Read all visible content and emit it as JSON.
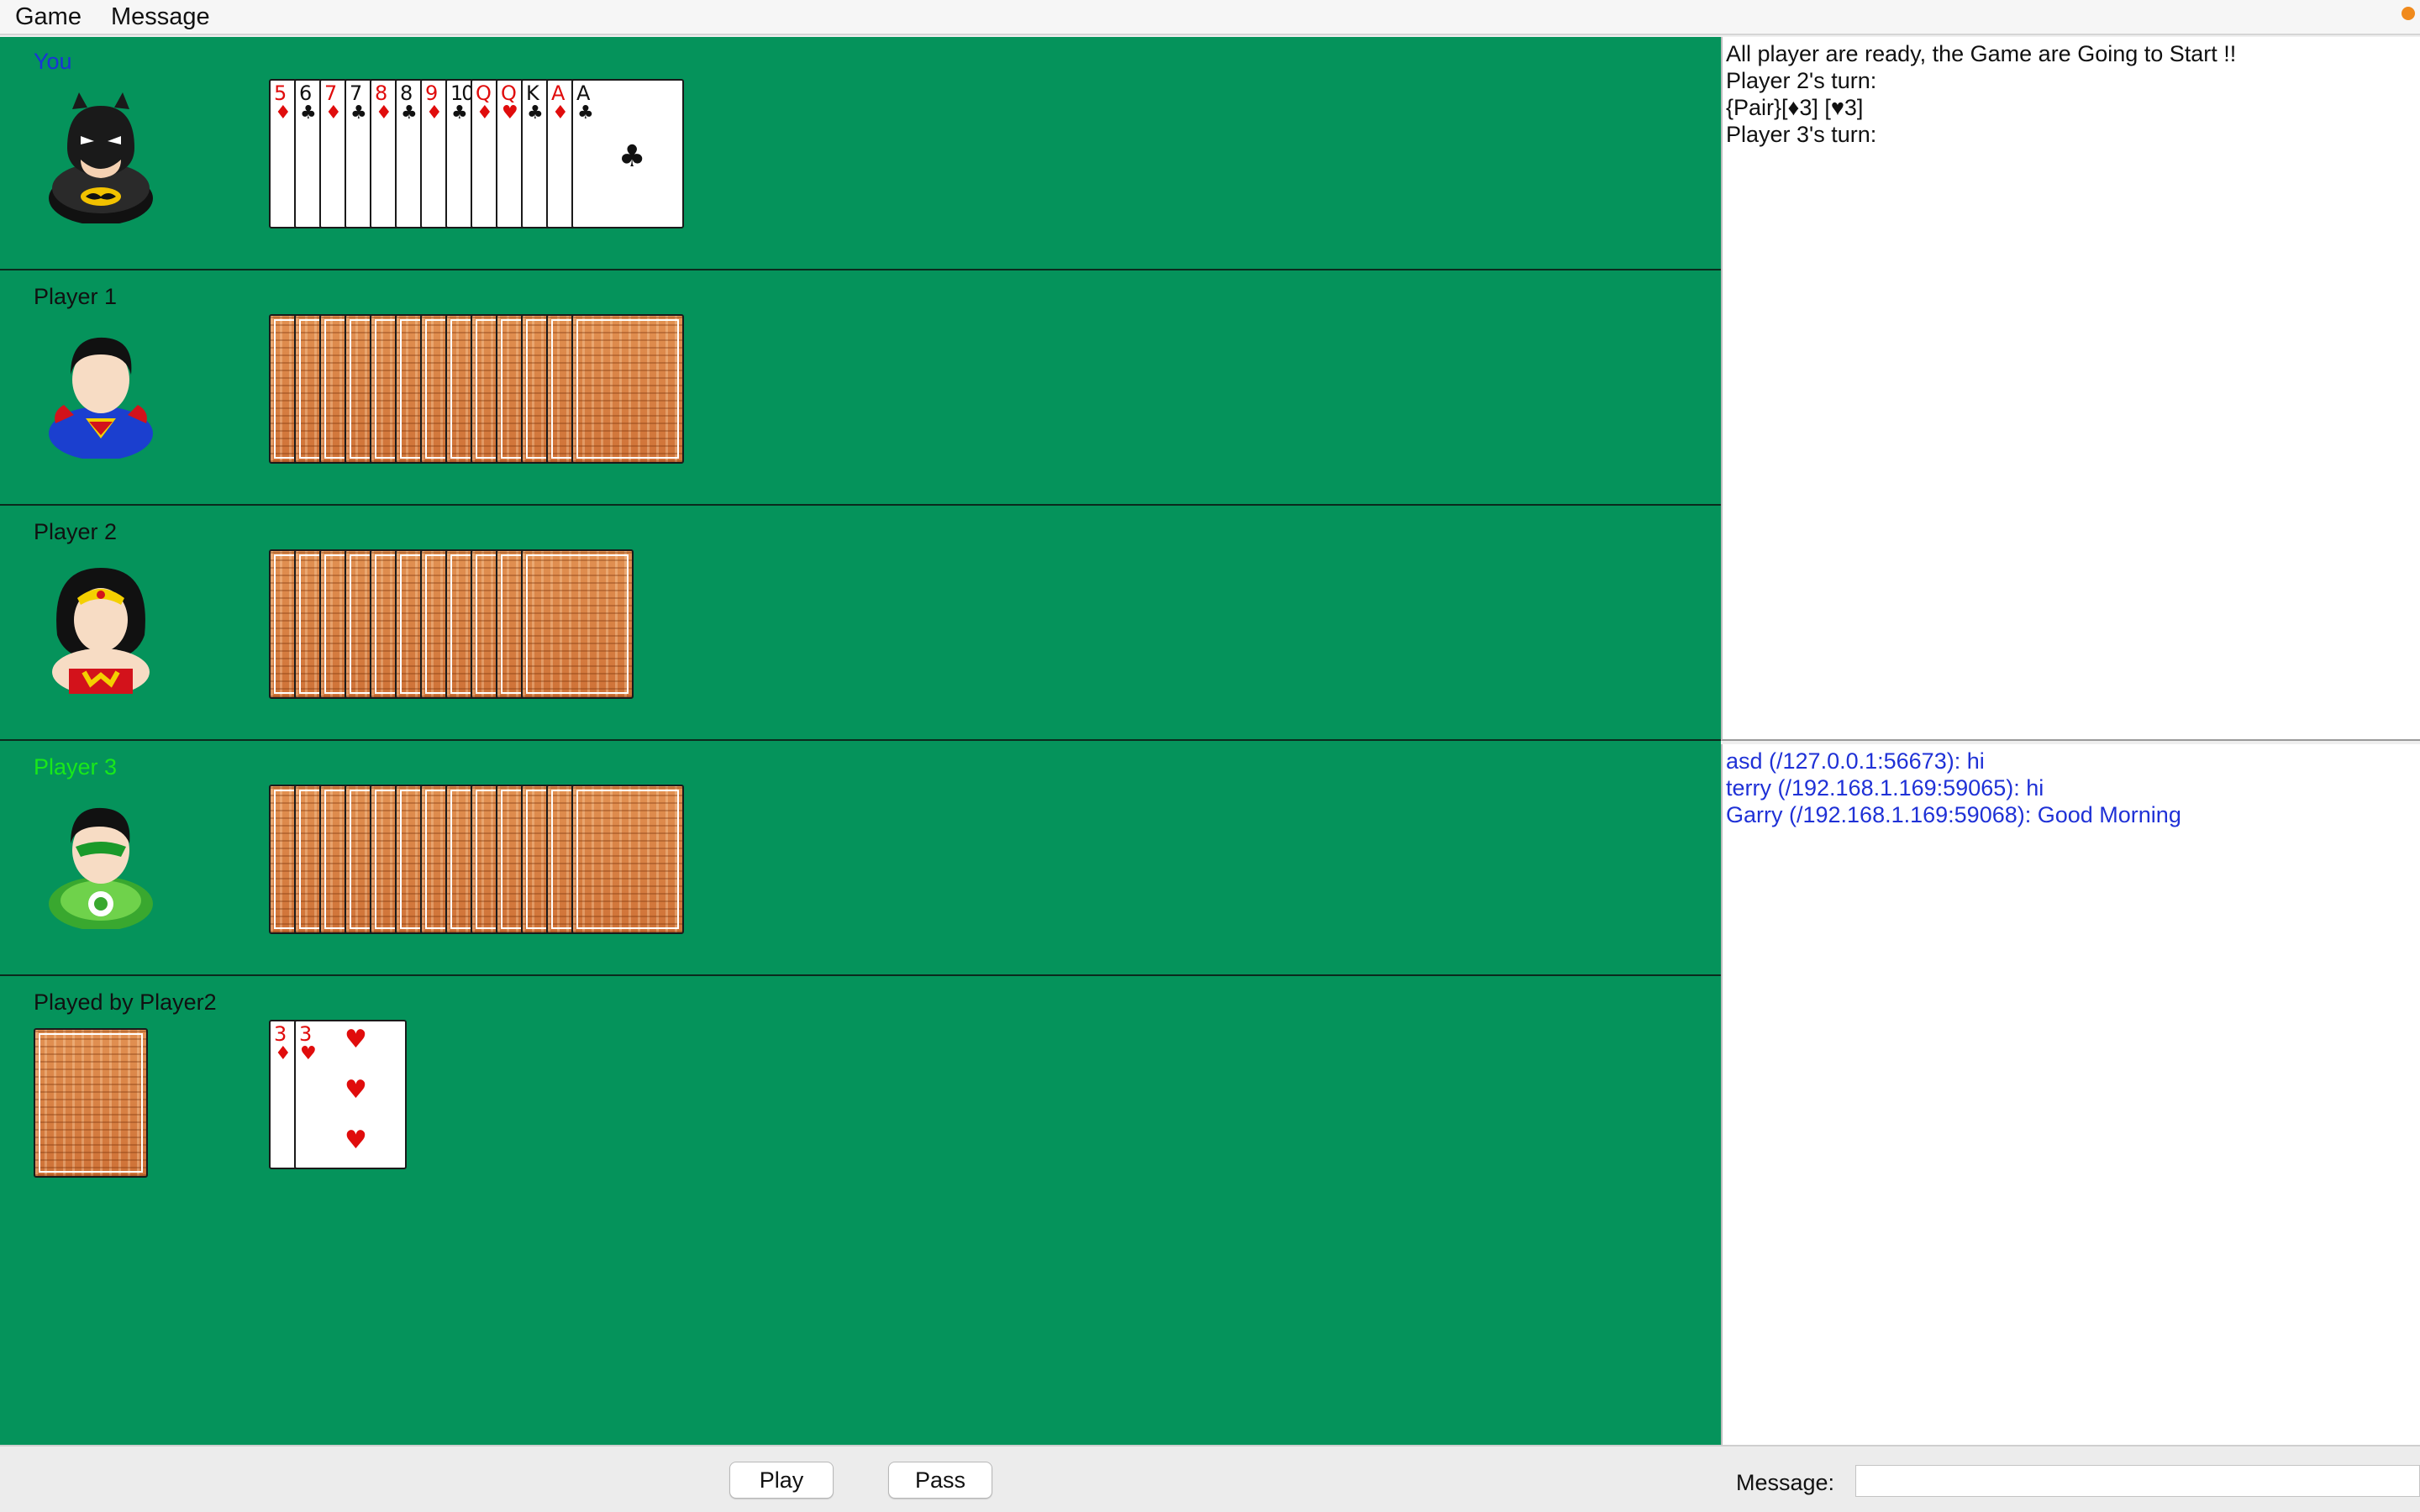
{
  "menu": {
    "game": "Game",
    "message": "Message"
  },
  "players": [
    {
      "name": "You",
      "name_color": "#1a33d8",
      "avatar": "batman-avatar"
    },
    {
      "name": "Player 1",
      "name_color": "#111111",
      "avatar": "superman-avatar",
      "card_count": 13
    },
    {
      "name": "Player 2",
      "name_color": "#111111",
      "avatar": "wonder-woman-avatar",
      "card_count": 11
    },
    {
      "name": "Player 3",
      "name_color": "#19e81a",
      "avatar": "green-lantern-avatar",
      "card_count": 13
    }
  ],
  "your_hand": [
    {
      "rank": "5",
      "suit": "♦",
      "color": "red"
    },
    {
      "rank": "6",
      "suit": "♣",
      "color": "black"
    },
    {
      "rank": "7",
      "suit": "♦",
      "color": "red"
    },
    {
      "rank": "7",
      "suit": "♣",
      "color": "black"
    },
    {
      "rank": "8",
      "suit": "♦",
      "color": "red"
    },
    {
      "rank": "8",
      "suit": "♣",
      "color": "black"
    },
    {
      "rank": "9",
      "suit": "♦",
      "color": "red"
    },
    {
      "rank": "10",
      "suit": "♣",
      "color": "black"
    },
    {
      "rank": "Q",
      "suit": "♦",
      "color": "red"
    },
    {
      "rank": "Q",
      "suit": "♥",
      "color": "red"
    },
    {
      "rank": "K",
      "suit": "♣",
      "color": "black"
    },
    {
      "rank": "A",
      "suit": "♦",
      "color": "red"
    },
    {
      "rank": "A",
      "suit": "♣",
      "color": "black"
    }
  ],
  "played": {
    "label": "Played by Player2",
    "cards": [
      {
        "rank": "3",
        "suit": "♦",
        "color": "red"
      },
      {
        "rank": "3",
        "suit": "♥",
        "color": "red"
      }
    ]
  },
  "log": [
    "All player are ready, the Game are Going to Start !!",
    "Player 2's turn:",
    "{Pair}[♦3] [♥3]",
    "Player 3's turn:"
  ],
  "chat": [
    "asd (/127.0.0.1:56673): hi",
    "terry (/192.168.1.169:59065): hi",
    "Garry (/192.168.1.169:59068): Good Morning"
  ],
  "buttons": {
    "play": "Play",
    "pass": "Pass"
  },
  "message_label": "Message:",
  "colors": {
    "table": "#05935b",
    "chat_text": "#1f31d6"
  }
}
